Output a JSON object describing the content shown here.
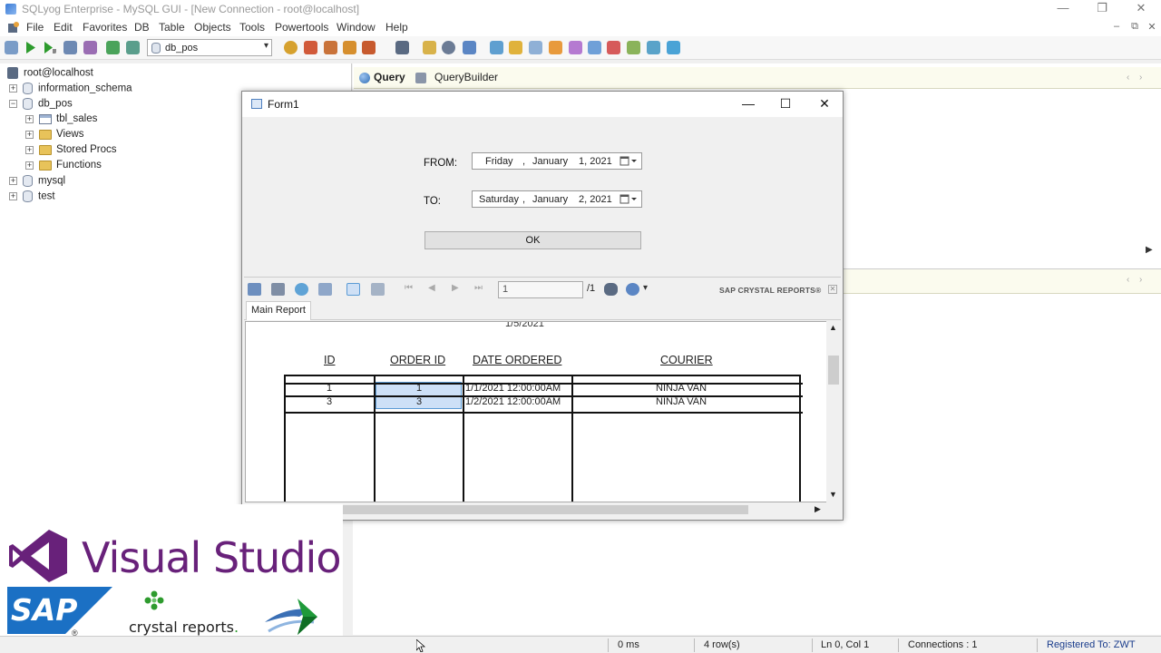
{
  "window": {
    "title": "SQLyog Enterprise - MySQL GUI - [New Connection - root@localhost]",
    "controls": {
      "minimize": "—",
      "restore": "❐",
      "close": "✕"
    }
  },
  "menu": [
    "File",
    "Edit",
    "Favorites",
    "DB",
    "Table",
    "Objects",
    "Tools",
    "Powertools",
    "Window",
    "Help"
  ],
  "mdi_controls": {
    "minimize": "–",
    "restore": "⧉",
    "close": "✕"
  },
  "toolbar": {
    "database": "db_pos"
  },
  "tree": {
    "root": "root@localhost",
    "nodes": [
      {
        "label": "information_schema",
        "expander": "+"
      },
      {
        "label": "db_pos",
        "expander": "−"
      },
      {
        "label": "tbl_sales",
        "expander": "+"
      },
      {
        "label": "Views",
        "expander": "+"
      },
      {
        "label": "Stored Procs",
        "expander": "+"
      },
      {
        "label": "Functions",
        "expander": "+"
      },
      {
        "label": "mysql",
        "expander": "+"
      },
      {
        "label": "test",
        "expander": "+"
      }
    ]
  },
  "editor_tabs": [
    "Query",
    "QueryBuilder"
  ],
  "form1": {
    "title": "Form1",
    "controls": {
      "minimize": "—",
      "maximize": "☐",
      "close": "✕"
    },
    "from_label": "FROM:",
    "to_label": "TO:",
    "from_date": {
      "day": "Friday",
      "month": "January",
      "date": "1, 2021"
    },
    "to_date": {
      "day": "Saturday",
      "month": "January",
      "date": "2, 2021"
    },
    "ok_label": "OK"
  },
  "crystal": {
    "page_value": "1",
    "page_total": "/1",
    "brand": "SAP CRYSTAL REPORTS®",
    "close_glyph": "✕",
    "tab": "Main Report",
    "report_date": "1/5/2021",
    "headers": [
      "ID",
      "ORDER ID",
      "DATE ORDERED",
      "COURIER"
    ],
    "rows": [
      [
        "1",
        "1",
        "1/1/2021  12:00:00AM",
        "NINJA VAN"
      ],
      [
        "3",
        "3",
        "1/2/2021  12:00:00AM",
        "NINJA VAN"
      ]
    ]
  },
  "logos": {
    "visual_studio": "Visual Studio",
    "sap": "SAP",
    "sap_reg": "®",
    "crystal": "crystal reports",
    "crystal_dot": "."
  },
  "status": {
    "time": "0 ms",
    "rows": "4 row(s)",
    "position": "Ln 0, Col 1",
    "connections": "Connections : 1",
    "registered": "Registered To: ZWT"
  }
}
